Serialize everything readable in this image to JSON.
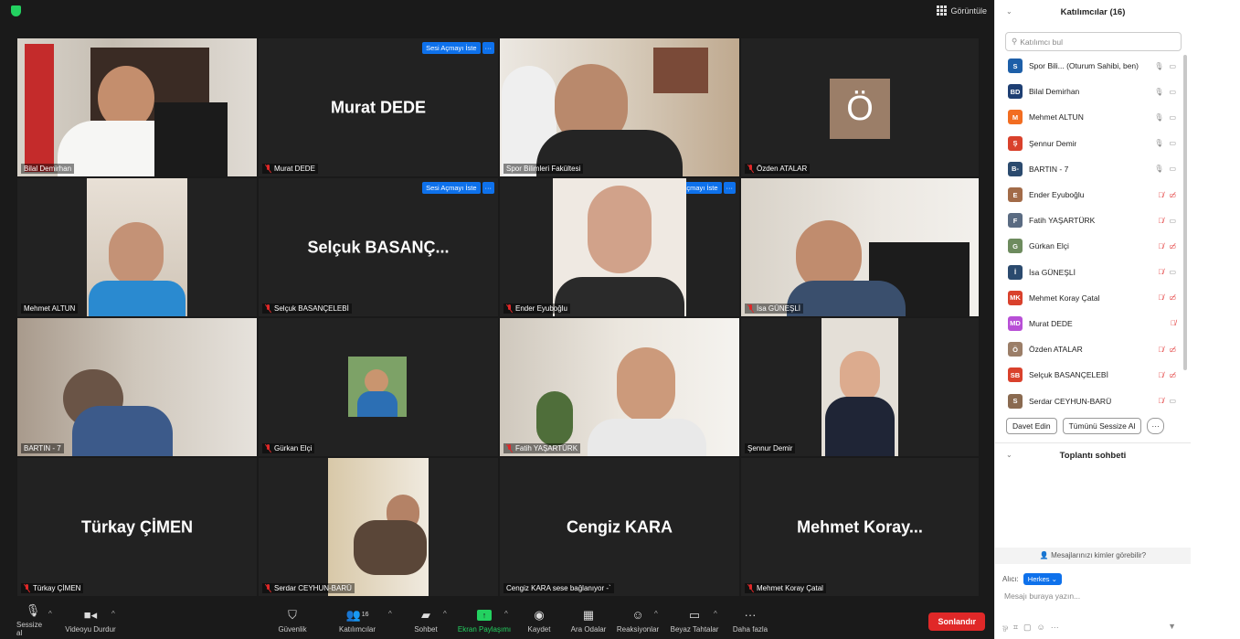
{
  "topbar": {
    "view_label": "Görüntüle"
  },
  "tiles": {
    "t1": {
      "label": "Bilal Demirhan"
    },
    "t2": {
      "big": "Murat DEDE",
      "label": "Murat DEDE"
    },
    "t3": {
      "label": "Spor Bilimleri Fakültesi"
    },
    "t4": {
      "avatar": "Ö",
      "label": "Özden ATALAR"
    },
    "t5": {
      "label": "Mehmet ALTUN"
    },
    "t6": {
      "big": "Selçuk  BASANÇ...",
      "label": "Selçuk BASANÇELEBİ"
    },
    "t7": {
      "label": "Ender Eyuboğlu"
    },
    "t8": {
      "label": "İsa GÜNEŞLİ"
    },
    "t9": {
      "label": "BARTIN - 7"
    },
    "t10": {
      "label": "Gürkan Elçi"
    },
    "t11": {
      "label": "Fatih YAŞARTÜRK"
    },
    "t12": {
      "label": "Şennur Demir"
    },
    "t13": {
      "big": "Türkay ÇİMEN",
      "label": "Türkay ÇİMEN"
    },
    "t14": {
      "label": "Serdar CEYHUN-BARÜ"
    },
    "t15": {
      "big": "Cengiz KARA",
      "label": "Cengiz KARA sese bağlanıyor -`"
    },
    "t16": {
      "big": "Mehmet  Koray...",
      "label": "Mehmet Koray Çatal"
    }
  },
  "unmute_request": {
    "label": "Sesi Açmayı İste",
    "more": "···"
  },
  "toolbar": {
    "mute": "Sessize al",
    "video": "Videoyu Durdur",
    "security": "Güvenlik",
    "participants": "Katılımcılar",
    "participants_count": "16",
    "chat": "Sohbet",
    "share": "Ekran Paylaşımı",
    "record": "Kaydet",
    "rooms": "Ara Odalar",
    "reactions": "Reaksiyonlar",
    "whiteboard": "Beyaz Tahtalar",
    "more": "Daha fazla",
    "more_icon": "···",
    "end": "Sonlandır"
  },
  "panel": {
    "title": "Katılımcılar (16)",
    "search_placeholder": "Katılımcı bul",
    "participants": [
      {
        "initials": "S",
        "name": "Spor Bili...  (Oturum Sahibi, ben)",
        "color": "#1d5fa8",
        "mic": "on",
        "cam": "on"
      },
      {
        "initials": "BD",
        "name": "Bilal Demirhan",
        "color": "#1e3f73",
        "mic": "on",
        "cam": "on"
      },
      {
        "initials": "M",
        "name": "Mehmet ALTUN",
        "color": "#f26d21",
        "mic": "on",
        "cam": "on"
      },
      {
        "initials": "Ş",
        "name": "Şennur Demir",
        "color": "#d9412c",
        "mic": "on",
        "cam": "on"
      },
      {
        "initials": "B-",
        "name": "BARTIN - 7",
        "color": "#2b4a6e",
        "mic": "on",
        "cam": "on"
      },
      {
        "initials": "E",
        "name": "Ender Eyuboğlu",
        "color": "#a26b48",
        "mic": "off",
        "cam": "off"
      },
      {
        "initials": "F",
        "name": "Fatih YAŞARTÜRK",
        "color": "#5a6b82",
        "mic": "off",
        "cam": "on"
      },
      {
        "initials": "G",
        "name": "Gürkan Elçi",
        "color": "#6d8b5e",
        "mic": "off",
        "cam": "off"
      },
      {
        "initials": "İ",
        "name": "İsa GÜNEŞLİ",
        "color": "#2b4a6e",
        "mic": "off",
        "cam": "on"
      },
      {
        "initials": "MK",
        "name": "Mehmet Koray Çatal",
        "color": "#d9412c",
        "mic": "off",
        "cam": "off"
      },
      {
        "initials": "MD",
        "name": "Murat DEDE",
        "color": "#b84fd6",
        "mic": "off",
        "cam": "none"
      },
      {
        "initials": "Ö",
        "name": "Özden ATALAR",
        "color": "#9b7e68",
        "mic": "off",
        "cam": "off"
      },
      {
        "initials": "SB",
        "name": "Selçuk BASANÇELEBİ",
        "color": "#d9412c",
        "mic": "off",
        "cam": "off"
      },
      {
        "initials": "S",
        "name": "Serdar CEYHUN-BARÜ",
        "color": "#8a6a50",
        "mic": "off",
        "cam": "on"
      }
    ],
    "invite": "Davet Edin",
    "mute_all": "Tümünü Sessize Al",
    "more": "···",
    "chat_title": "Toplantı sohbeti",
    "who_can_see": "Mesajlarınızı kimler görebilir?",
    "to_label": "Alıcı:",
    "to_value": "Herkes",
    "input_placeholder": "Mesajı buraya yazın..."
  }
}
